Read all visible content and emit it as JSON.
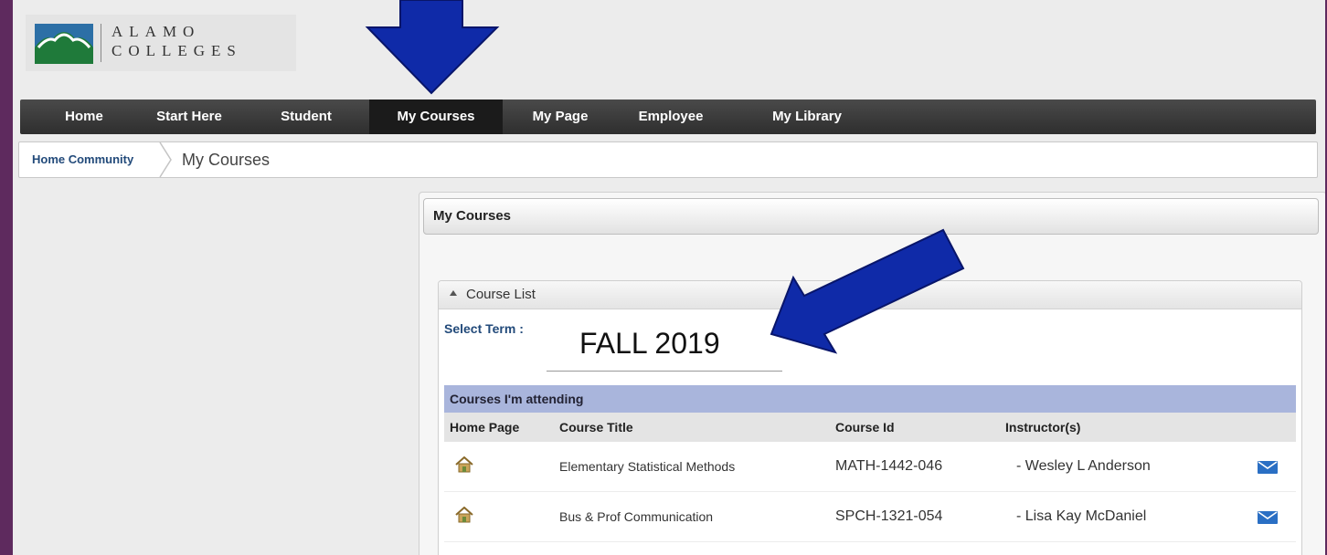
{
  "logo": {
    "line1": "ALAMO",
    "line2": "COLLEGES"
  },
  "nav": {
    "items": [
      {
        "label": "Home",
        "active": false
      },
      {
        "label": "Start Here",
        "active": false
      },
      {
        "label": "Student",
        "active": false
      },
      {
        "label": "My Courses",
        "active": true
      },
      {
        "label": "My Page",
        "active": false
      },
      {
        "label": "Employee",
        "active": false
      },
      {
        "label": "My Library",
        "active": false
      }
    ]
  },
  "breadcrumb": {
    "home": "Home Community",
    "current": "My Courses"
  },
  "panel": {
    "title": "My Courses"
  },
  "course_list": {
    "title": "Course List",
    "select_term_label": "Select Term :",
    "term_value": "FALL 2019",
    "section_title": "Courses I'm attending",
    "columns": [
      "Home Page",
      "Course Title",
      "Course Id",
      "Instructor(s)"
    ],
    "rows": [
      {
        "title": "Elementary Statistical Methods",
        "id": "MATH-1442-046",
        "instructor": "- Wesley L Anderson"
      },
      {
        "title": "Bus & Prof Communication",
        "id": "SPCH-1321-054",
        "instructor": "- Lisa Kay McDaniel"
      }
    ]
  },
  "icons": {
    "home": "home-icon",
    "mail": "mail-icon",
    "logo": "mission-logo-icon"
  },
  "colors": {
    "frame": "#5e2a5e",
    "arrow": "#0f2aa8",
    "nav_bar": "#3a3a3a",
    "section_header": "#a9b5dc",
    "link": "#224a7a"
  }
}
